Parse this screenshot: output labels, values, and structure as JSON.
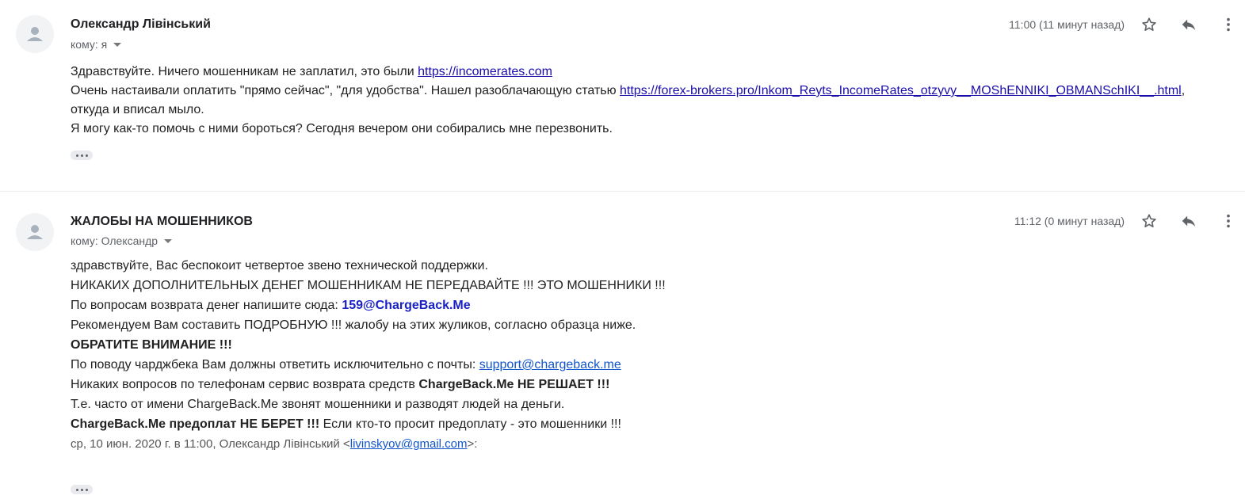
{
  "messages": [
    {
      "sender": "Олександр Лівінський",
      "to_label": "кому: я",
      "time": "11:00 (11 минут назад)",
      "lines": {
        "l1_text": "Здравствуйте. Ничего мошенникам не заплатил, это были ",
        "l1_link": "https://incomerates.com",
        "l2_text": "Очень настаивали оплатить \"прямо сейчас\", \"для удобства\". Нашел разоблачающую статью ",
        "l2_link": "https://forex-brokers.pro/Inkom_Reyts_IncomeRates_otzyvy__MOShENNIKI_OBMANSchIKI__.html",
        "l2_end": ",",
        "l3_text": "откуда и вписал мыло.",
        "l4_text": "Я могу как-то помочь с ними бороться? Сегодня вечером они собирались мне перезвонить."
      }
    },
    {
      "sender": "ЖАЛОБЫ НА МОШЕННИКОВ",
      "to_label": "кому: Олександр",
      "time": "11:12 (0 минут назад)",
      "lines": {
        "l1": "здравствуйте, Вас беспокоит четвертое звено технической поддержки.",
        "l2": "НИКАКИХ ДОПОЛНИТЕЛЬНЫХ ДЕНЕГ МОШЕННИКАМ НЕ ПЕРЕДАВАЙТЕ !!! ЭТО МОШЕННИКИ !!!",
        "l3_text": "По вопросам возврата денег напишите сюда: ",
        "l3_email": "159@ChargeBack.Me",
        "l4": "Рекомендуем Вам составить ПОДРОБНУЮ !!! жалобу на этих жуликов, согласно образца ниже.",
        "l5": "ОБРАТИТЕ ВНИМАНИЕ !!!",
        "l6_text": "По поводу чарджбека Вам должны ответить исключительно с почты: ",
        "l6_link": "support@chargeback.me",
        "l7_text": "Никаких вопросов по телефонам сервис возврата средств ",
        "l7_bold": "ChargeBack.Me НЕ РЕШАЕТ !!!",
        "l8": "Т.е. часто от имени ChargeBack.Me звонят мошенники и разводят людей на деньги.",
        "l9_bold": "ChargeBack.Me предоплат НЕ БЕРЕТ !!!",
        "l9_text": " Если кто-то просит предоплату - это мошенники !!!",
        "quote_prefix": "ср, 10 июн. 2020 г. в 11:00, Олександр Лівінський <",
        "quote_email": "livinskyov@gmail.com",
        "quote_suffix": ">:"
      }
    }
  ],
  "icons": [
    "avatar-icon",
    "star-icon",
    "reply-icon",
    "more-vert-icon",
    "chevron-down-icon",
    "expand-dots-icon"
  ],
  "colors": {
    "link": "#1a0dab",
    "email_accent": "#1a21c4",
    "meta_text": "#5f6368"
  }
}
